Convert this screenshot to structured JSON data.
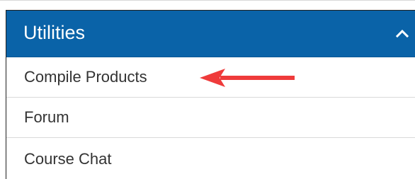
{
  "panel": {
    "title": "Utilities",
    "toggle_icon": "chevron-up-icon",
    "header_color": "#0a63a8",
    "annotation_color": "#ef3b3b"
  },
  "menu": {
    "items": [
      {
        "label": "Compile Products",
        "highlighted": true
      },
      {
        "label": "Forum",
        "highlighted": false
      },
      {
        "label": "Course Chat",
        "highlighted": false
      }
    ]
  }
}
